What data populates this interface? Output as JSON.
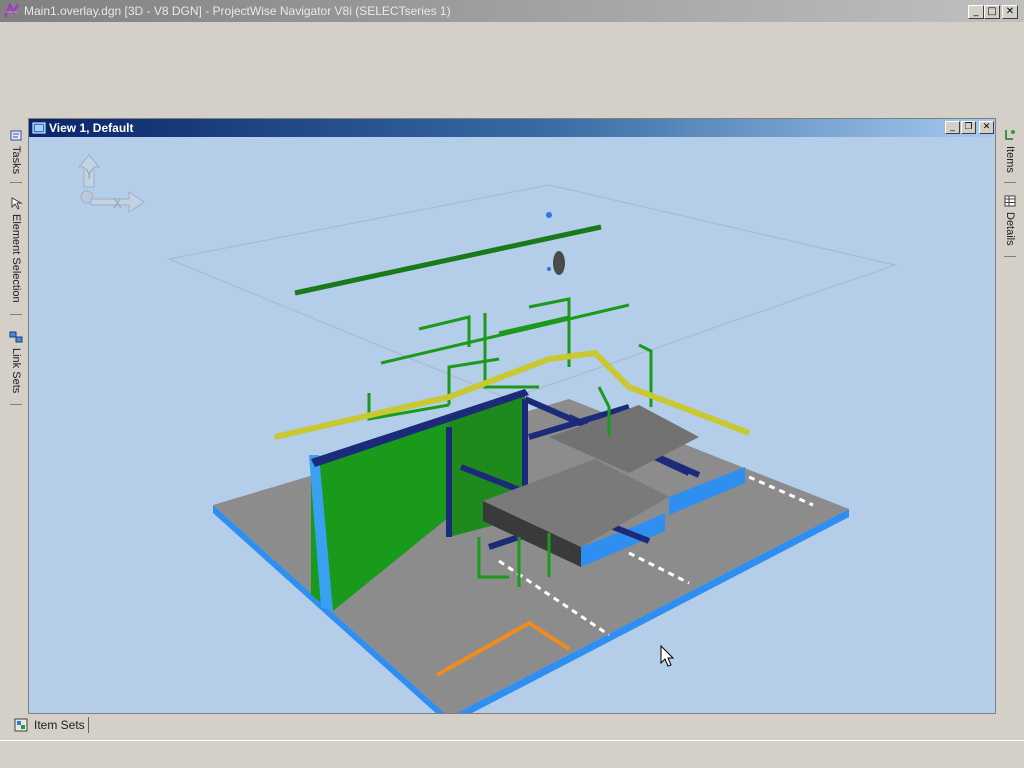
{
  "window": {
    "title": "Main1.overlay.dgn [3D - V8 DGN] - ProjectWise Navigator V8i (SELECTseries 1)",
    "minimize_label": "_",
    "maximize_label": "□",
    "close_label": "✕"
  },
  "left_panel": {
    "tabs": [
      {
        "label": "Tasks",
        "icon": "tasks-icon"
      },
      {
        "label": "Element Selection",
        "icon": "element-selection-icon"
      },
      {
        "label": "Link Sets",
        "icon": "link-sets-icon"
      }
    ]
  },
  "right_panel": {
    "tabs": [
      {
        "label": "Items",
        "icon": "items-icon"
      },
      {
        "label": "Details",
        "icon": "details-icon"
      }
    ]
  },
  "view": {
    "title": "View 1, Default",
    "minimize_label": "_",
    "restore_label": "❐",
    "close_label": "✕",
    "axis_y_label": "Y",
    "axis_x_label": "X"
  },
  "bottom_bar": {
    "item_sets_label": "Item Sets",
    "icon": "item-sets-icon"
  },
  "colors": {
    "viewport_bg": "#b4cde8",
    "slab_top": "#8c8c8c",
    "slab_edge": "#2e8ff0",
    "structure_green": "#1a9a1a",
    "steel_blue": "#1c2a7a",
    "pipe_yellow": "#c8c832",
    "marking_orange": "#f08c1e"
  }
}
